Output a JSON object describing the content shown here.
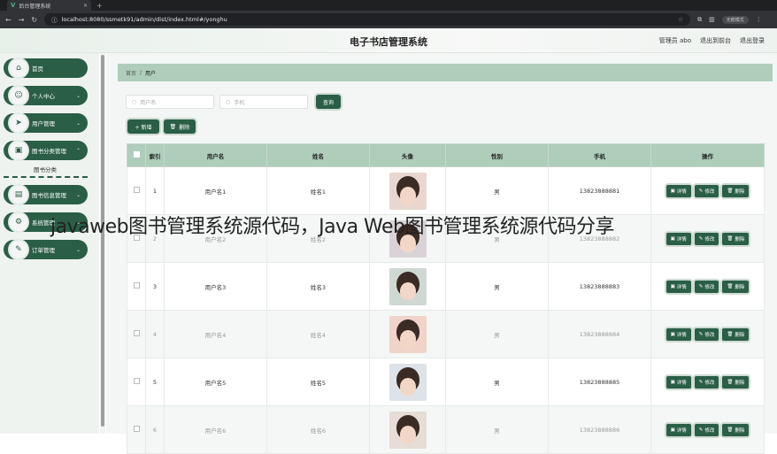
{
  "browser": {
    "tab_title": "后台管理系统",
    "url": "localhost:8080/ssmetk91/admin/dist/index.html#/yonghu",
    "profile_label": "无痕模式"
  },
  "header": {
    "title": "电子书店管理系统",
    "admin_label": "管理员 abo",
    "to_front_label": "退出到前台",
    "logout_label": "退出登录"
  },
  "sidebar": {
    "items": [
      {
        "label": "首页",
        "icon": "home-icon",
        "glyph": "⌂",
        "chevron": false
      },
      {
        "label": "个人中心",
        "icon": "user-icon",
        "glyph": "☺",
        "chevron": true
      },
      {
        "label": "用户管理",
        "icon": "send-icon",
        "glyph": "➤",
        "chevron": true
      },
      {
        "label": "图书分类管理",
        "icon": "book-icon",
        "glyph": "▣",
        "chevron": true
      },
      {
        "label": "图书信息管理",
        "icon": "list-icon",
        "glyph": "▤",
        "chevron": true
      },
      {
        "label": "系统管理",
        "icon": "settings-icon",
        "glyph": "⚙",
        "chevron": true
      },
      {
        "label": "订单管理",
        "icon": "order-icon",
        "glyph": "✎",
        "chevron": true
      }
    ],
    "sub_item": "图书分类"
  },
  "breadcrumb": {
    "home": "首页",
    "sep": "/",
    "current": "用户"
  },
  "filters": {
    "username_placeholder": "用户名",
    "phone_placeholder": "手机",
    "search_label": "查询",
    "add_label": "+ 新增",
    "delete_label": "删除"
  },
  "table": {
    "headers": [
      "索引",
      "用户名",
      "姓名",
      "头像",
      "性别",
      "手机",
      "操作"
    ],
    "rows": [
      {
        "index": "1",
        "username": "用户名1",
        "name": "姓名1",
        "gender": "男",
        "phone": "13823888881"
      },
      {
        "index": "2",
        "username": "用户名2",
        "name": "姓名2",
        "gender": "男",
        "phone": "13823888882"
      },
      {
        "index": "3",
        "username": "用户名3",
        "name": "姓名3",
        "gender": "男",
        "phone": "13823888883"
      },
      {
        "index": "4",
        "username": "用户名4",
        "name": "姓名4",
        "gender": "男",
        "phone": "13823888884"
      },
      {
        "index": "5",
        "username": "用户名5",
        "name": "姓名5",
        "gender": "男",
        "phone": "13823888885"
      },
      {
        "index": "6",
        "username": "用户名6",
        "name": "姓名6",
        "gender": "男",
        "phone": "13823888886"
      }
    ],
    "op_labels": {
      "detail": "详情",
      "edit": "修改",
      "delete": "删除"
    }
  },
  "watermark": "javaweb图书管理系统源代码，Java Web图书管理系统源代码分享",
  "colors": {
    "accent": "#2a5e47",
    "accent_light": "#aecdba"
  }
}
